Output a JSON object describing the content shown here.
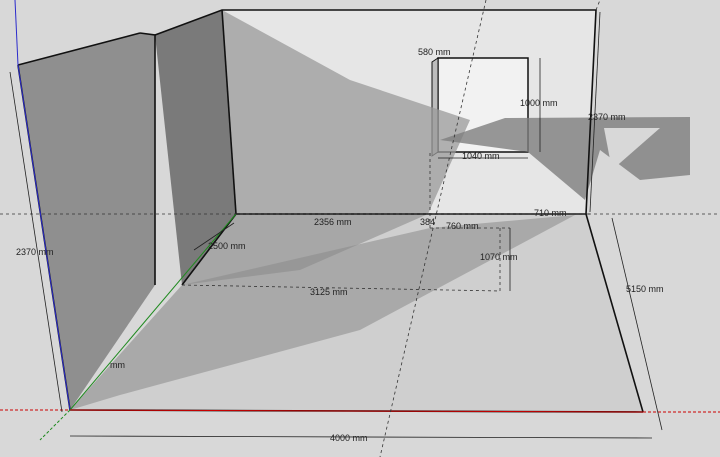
{
  "colors": {
    "background": "#d8d8d8",
    "wall_back": "#e6e6e6",
    "wall_left": "#8f8f8f",
    "wall_left_dark": "#7a7a7a",
    "floor": "#cfcfcf",
    "shadow": "#8d8d8d",
    "edge": "#111111",
    "axis_red": "#cc0000",
    "axis_green": "#1f8a1f",
    "axis_blue": "#2b2bcc"
  },
  "dimensions": {
    "back_wall_height": "2370 mm",
    "left_wall_height": "2370 mm",
    "window_left_offset": "580 mm",
    "window_height": "1000 mm",
    "window_width": "1040 mm",
    "right_offset": "710 mm",
    "floor_back_length": "2356 mm",
    "floor_back_small": "384",
    "floor_rect_width": "760 mm",
    "floor_rect_depth": "1070 mm",
    "floor_rect_length": "3125 mm",
    "floor_left_depth": "2500 mm",
    "floor_depth": "5150 mm",
    "floor_width": "4000 mm",
    "axis_label": "mm"
  }
}
